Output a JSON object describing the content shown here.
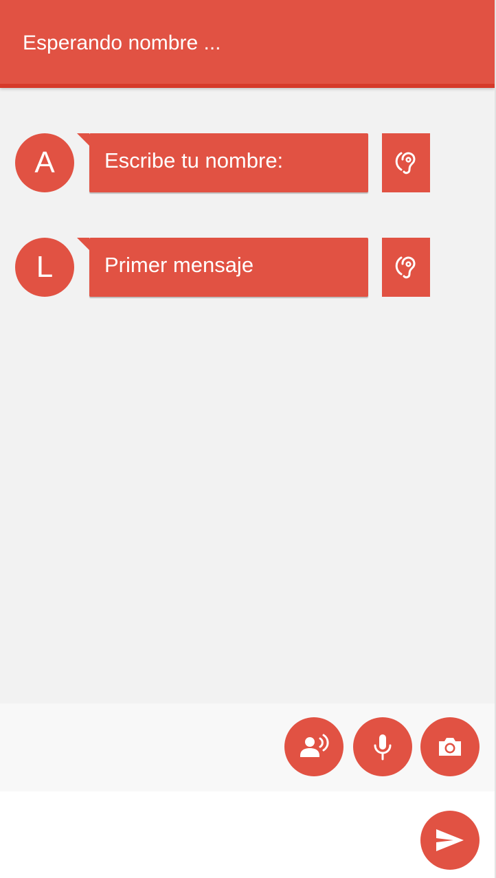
{
  "header": {
    "title": "Esperando nombre ..."
  },
  "messages": [
    {
      "avatar_letter": "A",
      "text": "Escribe tu nombre:",
      "action_icon": "ear-icon"
    },
    {
      "avatar_letter": "L",
      "text": "Primer mensaje",
      "action_icon": "ear-icon"
    }
  ],
  "toolbar": {
    "buttons": [
      {
        "icon": "record-voice-icon"
      },
      {
        "icon": "microphone-icon"
      },
      {
        "icon": "camera-icon"
      }
    ]
  },
  "composer": {
    "input_value": "",
    "send_icon": "send-icon"
  },
  "colors": {
    "accent": "#e15243",
    "accent_dark": "#d63a2a",
    "chat_background": "#f2f2f2",
    "toolbar_background": "#f8f8f8",
    "text_on_accent": "#ffffff"
  }
}
